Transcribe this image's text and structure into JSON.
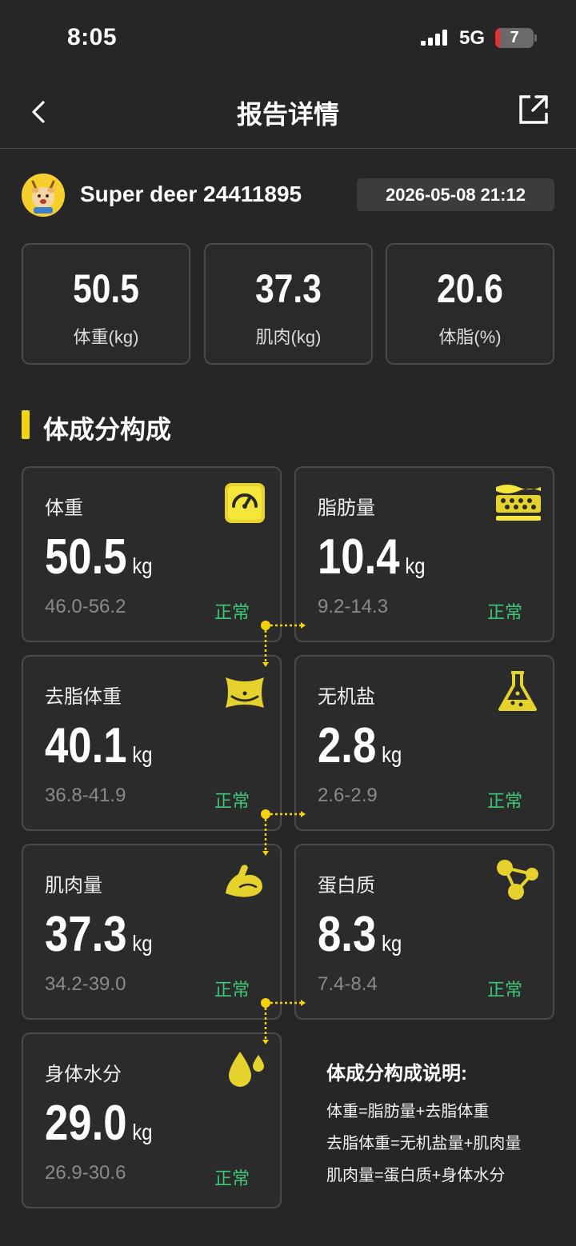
{
  "status_bar": {
    "time": "8:05",
    "network": "5G",
    "battery": "7"
  },
  "nav": {
    "title": "报告详情"
  },
  "profile": {
    "username": "Super deer 24411895",
    "datetime": "2026-05-08 21:12"
  },
  "summary": [
    {
      "value": "50.5",
      "label": "体重(kg)"
    },
    {
      "value": "37.3",
      "label": "肌肉(kg)"
    },
    {
      "value": "20.6",
      "label": "体脂(%)"
    }
  ],
  "section": {
    "title": "体成分构成"
  },
  "metrics": [
    {
      "name": "体重",
      "value": "50.5",
      "unit": "kg",
      "range": "46.0-56.2",
      "status": "正常",
      "icon": "scale-icon"
    },
    {
      "name": "脂肪量",
      "value": "10.4",
      "unit": "kg",
      "range": "9.2-14.3",
      "status": "正常",
      "icon": "fat-layer-icon"
    },
    {
      "name": "去脂体重",
      "value": "40.1",
      "unit": "kg",
      "range": "36.8-41.9",
      "status": "正常",
      "icon": "waist-icon"
    },
    {
      "name": "无机盐",
      "value": "2.8",
      "unit": "kg",
      "range": "2.6-2.9",
      "status": "正常",
      "icon": "flask-icon"
    },
    {
      "name": "肌肉量",
      "value": "37.3",
      "unit": "kg",
      "range": "34.2-39.0",
      "status": "正常",
      "icon": "muscle-icon"
    },
    {
      "name": "蛋白质",
      "value": "8.3",
      "unit": "kg",
      "range": "7.4-8.4",
      "status": "正常",
      "icon": "molecule-icon"
    },
    {
      "name": "身体水分",
      "value": "29.0",
      "unit": "kg",
      "range": "26.9-30.6",
      "status": "正常",
      "icon": "water-drop-icon"
    }
  ],
  "explanation": {
    "title": "体成分构成说明:",
    "lines": [
      "体重=脂肪量+去脂体重",
      "去脂体重=无机盐量+肌肉量",
      "肌肉量=蛋白质+身体水分"
    ]
  },
  "colors": {
    "background": "#262626",
    "accent": "#f5d20b",
    "normal": "#3cc878",
    "card_border": "#4a4a4a"
  }
}
